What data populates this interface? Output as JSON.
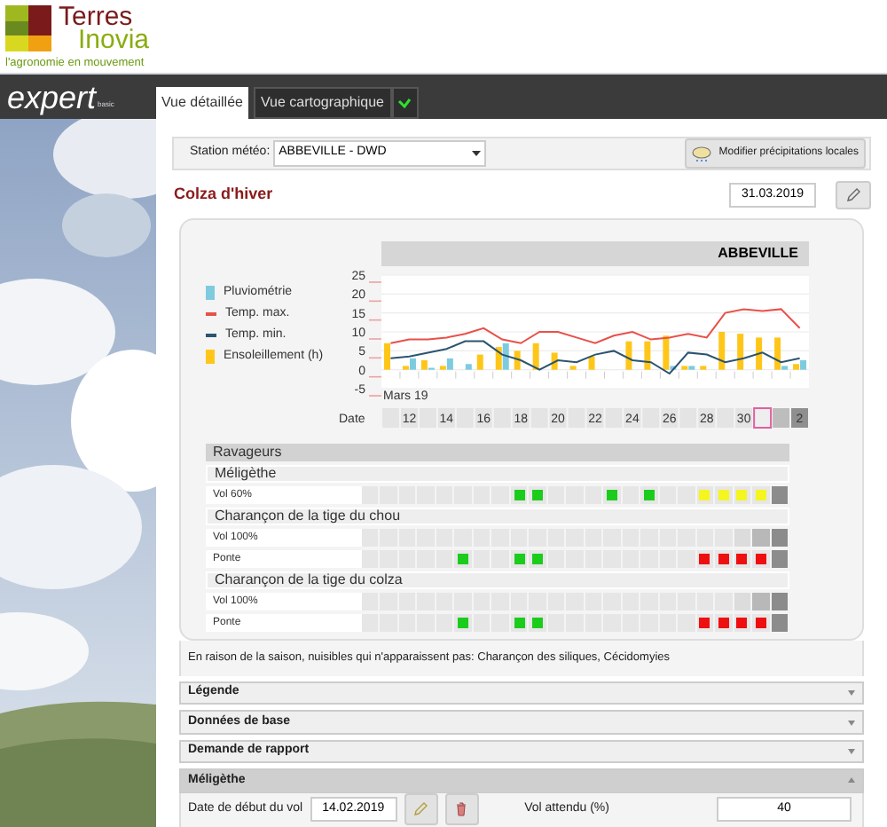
{
  "brand": {
    "name_top": "Terres",
    "name_bottom": "Inovia",
    "tagline": "l'agronomie en mouvement"
  },
  "app_bar": {
    "product": "expert",
    "edition": "basic",
    "tabs": [
      {
        "label": "Vue détaillée",
        "selected": true
      },
      {
        "label": "Vue cartographique",
        "selected": false
      }
    ]
  },
  "station": {
    "label": "Station météo:",
    "value": "ABBEVILLE - DWD",
    "button": "Modifier précipitations locales"
  },
  "crop": {
    "title": "Colza d'hiver",
    "date": "31.03.2019"
  },
  "chart": {
    "header": "ABBEVILLE",
    "start_label": "Mars 19",
    "chart_data": {
      "type": "bar",
      "xlabel": "Date",
      "categories": [
        null,
        "12",
        null,
        "14",
        null,
        "16",
        null,
        "18",
        null,
        "20",
        null,
        "22",
        null,
        "24",
        null,
        "26",
        null,
        "28",
        null,
        "30",
        null,
        null,
        "2"
      ],
      "ylim": [
        -5,
        25
      ],
      "yticks": [
        -5,
        0,
        5,
        10,
        15,
        20,
        25
      ],
      "grid": true,
      "series": [
        {
          "name": "Pluviométrie",
          "color": "#7ecbe0",
          "values": [
            0,
            3,
            0.5,
            3,
            1.5,
            0,
            7,
            0,
            0,
            0,
            0,
            0,
            0,
            0,
            0,
            1,
            1,
            0,
            0,
            0,
            0,
            1,
            2.5
          ]
        },
        {
          "name": "Ensoleillement (h)",
          "color": "#ffc61a",
          "values": [
            7,
            1,
            2.5,
            1,
            0,
            4,
            6,
            5,
            7,
            4.5,
            1,
            3.5,
            0,
            7.5,
            7.5,
            9,
            1,
            1,
            10,
            9.5,
            8.5,
            8.5,
            1.5
          ]
        }
      ]
    },
    "temperature": {
      "chart_data": {
        "type": "line",
        "ylim": [
          -5,
          25
        ],
        "series": [
          {
            "name": "Temp. max.",
            "color": "#e8504a",
            "values": [
              7,
              8,
              8,
              8.5,
              9.5,
              11,
              8,
              7,
              10,
              10,
              8.5,
              7,
              9,
              10,
              8,
              8.5,
              9.5,
              8.5,
              15,
              16,
              15.5,
              16,
              11
            ]
          },
          {
            "name": "Temp. min.",
            "color": "#2b5470",
            "values": [
              3,
              3.5,
              4.5,
              5.5,
              7.5,
              7.5,
              4,
              2.5,
              0,
              2.5,
              2,
              4,
              5,
              2.5,
              2,
              -1,
              4.5,
              4,
              2,
              3,
              4.5,
              2,
              3
            ]
          }
        ]
      }
    },
    "days": [
      {
        "selected": false,
        "forecast": false
      },
      {
        "selected": false,
        "forecast": false
      },
      {
        "selected": false,
        "forecast": false
      },
      {
        "selected": false,
        "forecast": false
      },
      {
        "selected": false,
        "forecast": false
      },
      {
        "selected": false,
        "forecast": false
      },
      {
        "selected": false,
        "forecast": false
      },
      {
        "selected": false,
        "forecast": false
      },
      {
        "selected": false,
        "forecast": false
      },
      {
        "selected": false,
        "forecast": false
      },
      {
        "selected": false,
        "forecast": false
      },
      {
        "selected": false,
        "forecast": false
      },
      {
        "selected": false,
        "forecast": false
      },
      {
        "selected": false,
        "forecast": false
      },
      {
        "selected": false,
        "forecast": false
      },
      {
        "selected": false,
        "forecast": false
      },
      {
        "selected": false,
        "forecast": false
      },
      {
        "selected": false,
        "forecast": false
      },
      {
        "selected": false,
        "forecast": false
      },
      {
        "selected": false,
        "forecast": false
      },
      {
        "selected": true,
        "forecast": false
      },
      {
        "selected": false,
        "forecast": true
      },
      {
        "selected": false,
        "forecast": true
      }
    ]
  },
  "pests": {
    "title": "Ravageurs",
    "groups": [
      {
        "name": "Méligèthe",
        "rows": [
          {
            "label": "Vol 60%",
            "cells": [
              {
                "marked": false
              },
              {
                "marked": false
              },
              {
                "marked": false
              },
              {
                "marked": false
              },
              {
                "marked": false
              },
              {
                "marked": false
              },
              {
                "marked": false
              },
              {
                "marked": false
              },
              {
                "marked": true,
                "color": "#1ccc1c"
              },
              {
                "marked": true,
                "color": "#1ccc1c"
              },
              {
                "marked": false
              },
              {
                "marked": false
              },
              {
                "marked": false
              },
              {
                "marked": true,
                "color": "#1ccc1c"
              },
              {
                "marked": false
              },
              {
                "marked": true,
                "color": "#1ccc1c"
              },
              {
                "marked": false
              },
              {
                "marked": false
              },
              {
                "marked": true,
                "color": "#f5f520"
              },
              {
                "marked": true,
                "color": "#f5f520"
              },
              {
                "marked": true,
                "color": "#f5f520"
              },
              {
                "marked": true,
                "color": "#f5f520"
              },
              {
                "marked": false
              }
            ]
          }
        ]
      },
      {
        "name": "Charançon de la tige du chou",
        "rows": [
          {
            "label": "Vol 100%",
            "cells": [
              {
                "marked": false
              },
              {
                "marked": false
              },
              {
                "marked": false
              },
              {
                "marked": false
              },
              {
                "marked": false
              },
              {
                "marked": false
              },
              {
                "marked": false
              },
              {
                "marked": false
              },
              {
                "marked": false
              },
              {
                "marked": false
              },
              {
                "marked": false
              },
              {
                "marked": false
              },
              {
                "marked": false
              },
              {
                "marked": false
              },
              {
                "marked": false
              },
              {
                "marked": false
              },
              {
                "marked": false
              },
              {
                "marked": false
              },
              {
                "marked": false
              },
              {
                "marked": false
              },
              {
                "marked": false
              },
              {
                "marked": false
              },
              {
                "marked": false
              }
            ]
          },
          {
            "label": "Ponte",
            "cells": [
              {
                "marked": false
              },
              {
                "marked": false
              },
              {
                "marked": false
              },
              {
                "marked": false
              },
              {
                "marked": false
              },
              {
                "marked": true,
                "color": "#1ccc1c"
              },
              {
                "marked": false
              },
              {
                "marked": false
              },
              {
                "marked": true,
                "color": "#1ccc1c"
              },
              {
                "marked": true,
                "color": "#1ccc1c"
              },
              {
                "marked": false
              },
              {
                "marked": false
              },
              {
                "marked": false
              },
              {
                "marked": false
              },
              {
                "marked": false
              },
              {
                "marked": false
              },
              {
                "marked": false
              },
              {
                "marked": false
              },
              {
                "marked": true,
                "color": "#ee1010"
              },
              {
                "marked": true,
                "color": "#ee1010"
              },
              {
                "marked": true,
                "color": "#ee1010"
              },
              {
                "marked": true,
                "color": "#ee1010"
              },
              {
                "marked": false
              }
            ]
          }
        ]
      },
      {
        "name": "Charançon de la tige du colza",
        "rows": [
          {
            "label": "Vol 100%",
            "cells": [
              {
                "marked": false
              },
              {
                "marked": false
              },
              {
                "marked": false
              },
              {
                "marked": false
              },
              {
                "marked": false
              },
              {
                "marked": false
              },
              {
                "marked": false
              },
              {
                "marked": false
              },
              {
                "marked": false
              },
              {
                "marked": false
              },
              {
                "marked": false
              },
              {
                "marked": false
              },
              {
                "marked": false
              },
              {
                "marked": false
              },
              {
                "marked": false
              },
              {
                "marked": false
              },
              {
                "marked": false
              },
              {
                "marked": false
              },
              {
                "marked": false
              },
              {
                "marked": false
              },
              {
                "marked": false
              },
              {
                "marked": false
              },
              {
                "marked": false
              }
            ]
          },
          {
            "label": "Ponte",
            "cells": [
              {
                "marked": false
              },
              {
                "marked": false
              },
              {
                "marked": false
              },
              {
                "marked": false
              },
              {
                "marked": false
              },
              {
                "marked": true,
                "color": "#1ccc1c"
              },
              {
                "marked": false
              },
              {
                "marked": false
              },
              {
                "marked": true,
                "color": "#1ccc1c"
              },
              {
                "marked": true,
                "color": "#1ccc1c"
              },
              {
                "marked": false
              },
              {
                "marked": false
              },
              {
                "marked": false
              },
              {
                "marked": false
              },
              {
                "marked": false
              },
              {
                "marked": false
              },
              {
                "marked": false
              },
              {
                "marked": false
              },
              {
                "marked": true,
                "color": "#ee1010"
              },
              {
                "marked": true,
                "color": "#ee1010"
              },
              {
                "marked": true,
                "color": "#ee1010"
              },
              {
                "marked": true,
                "color": "#ee1010"
              },
              {
                "marked": false
              }
            ]
          }
        ]
      }
    ]
  },
  "note": "En raison de la saison, nuisibles qui n'apparaissent pas: Charançon des siliques, Cécidomyies",
  "sections": [
    {
      "title": "Légende",
      "expanded": false
    },
    {
      "title": "Données de base",
      "expanded": false
    },
    {
      "title": "Demande de rapport",
      "expanded": false
    },
    {
      "title": "Méligèthe",
      "expanded": true
    }
  ],
  "flight": {
    "start_label": "Date de début du vol",
    "start_value": "14.02.2019",
    "expected_label": "Vol attendu (%)",
    "expected_value": "40"
  }
}
